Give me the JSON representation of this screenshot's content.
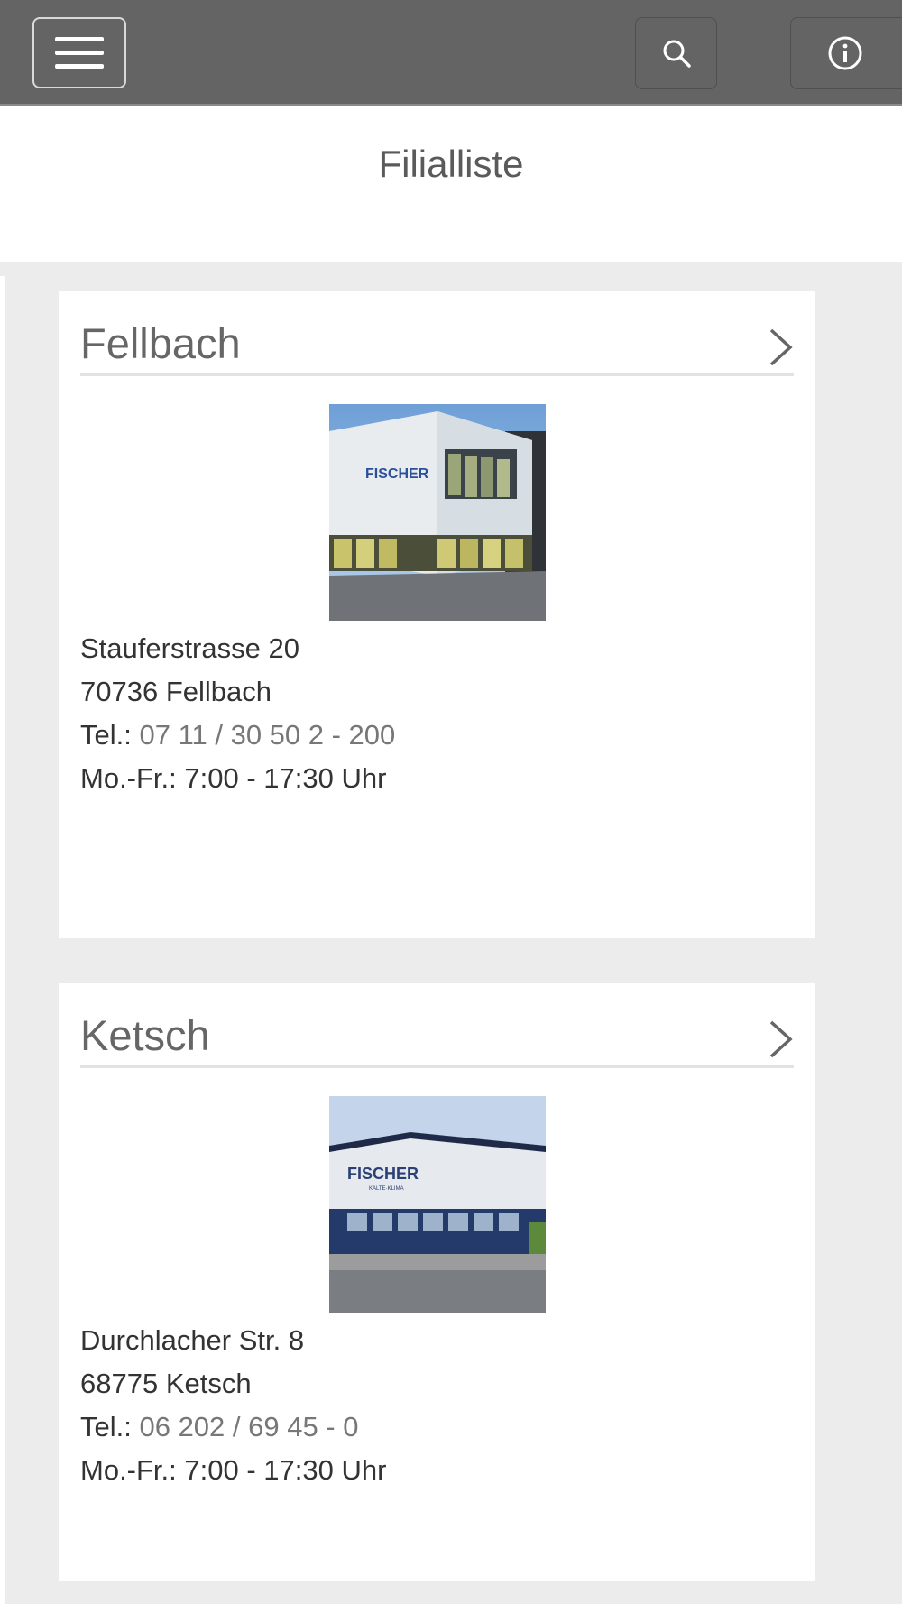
{
  "header": {
    "menu_icon": "hamburger-menu-icon",
    "search_icon": "search-icon",
    "info_icon": "info-icon",
    "bar_color": "#646464"
  },
  "page": {
    "title": "Filialliste"
  },
  "branches": [
    {
      "name": "Fellbach",
      "street": "Stauferstrasse 20",
      "city": "70736 Fellbach",
      "tel_label": "Tel.: ",
      "tel_number": "07 11 / 30 50 2 - 200",
      "hours": "Mo.-Fr.: 7:00 - 17:30 Uhr",
      "photo_sign": "FISCHER"
    },
    {
      "name": "Ketsch",
      "street": "Durchlacher Str. 8",
      "city": "68775 Ketsch",
      "tel_label": "Tel.: ",
      "tel_number": "06 202 / 69 45 - 0",
      "hours": "Mo.-Fr.: 7:00 - 17:30 Uhr",
      "photo_sign": "FISCHER",
      "photo_subsign": "KÄLTE·KLIMA"
    }
  ]
}
